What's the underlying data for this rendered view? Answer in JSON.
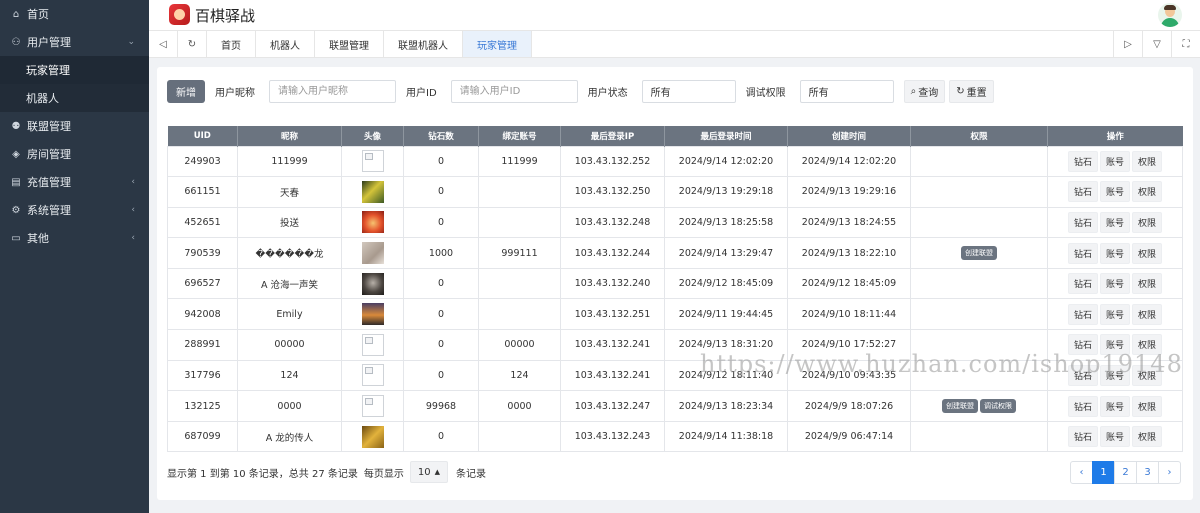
{
  "app": {
    "title": "百棋驿战"
  },
  "sidebar": {
    "items": [
      {
        "label": "首页",
        "icon": "home-icon",
        "glyph": "⌂"
      },
      {
        "label": "用户管理",
        "icon": "users-icon",
        "glyph": "⚇",
        "arrow": "⌄"
      },
      {
        "label": "联盟管理",
        "icon": "group-icon",
        "glyph": "⚉"
      },
      {
        "label": "房间管理",
        "icon": "diamond-icon",
        "glyph": "◈"
      },
      {
        "label": "充值管理",
        "icon": "document-icon",
        "glyph": "▤",
        "arrow": "‹"
      },
      {
        "label": "系统管理",
        "icon": "gear-icon",
        "glyph": "⚙",
        "arrow": "‹"
      },
      {
        "label": "其他",
        "icon": "briefcase-icon",
        "glyph": "▭",
        "arrow": "‹"
      }
    ],
    "submenu": [
      {
        "label": "玩家管理"
      },
      {
        "label": "机器人"
      }
    ]
  },
  "tabsbar": {
    "tabs": [
      "首页",
      "机器人",
      "联盟管理",
      "联盟机器人",
      "玩家管理"
    ],
    "active_index": 4
  },
  "filters": {
    "add_label": "新增",
    "nickname_label": "用户昵称",
    "nickname_placeholder": "请输入用户昵称",
    "userid_label": "用户ID",
    "userid_placeholder": "请输入用户ID",
    "status_label": "用户状态",
    "status_value": "所有",
    "debug_label": "调试权限",
    "debug_value": "所有",
    "search_label": "查询",
    "reset_label": "重置"
  },
  "table": {
    "columns": [
      "UID",
      "昵称",
      "头像",
      "钻石数",
      "绑定账号",
      "最后登录IP",
      "最后登录时间",
      "创建时间",
      "权限",
      "操作"
    ],
    "actions": [
      "钻石",
      "账号",
      "权限"
    ],
    "rows": [
      {
        "uid": "249903",
        "nick": "111999",
        "avatar": "broken",
        "diamonds": "0",
        "bound": "111999",
        "ip": "103.43.132.252",
        "last_login": "2024/9/14 12:02:20",
        "created": "2024/9/14 12:02:20",
        "perms": []
      },
      {
        "uid": "661151",
        "nick": "天春",
        "avatar": "t-leaf",
        "diamonds": "0",
        "bound": "",
        "ip": "103.43.132.250",
        "last_login": "2024/9/13 19:29:18",
        "created": "2024/9/13 19:29:16",
        "perms": []
      },
      {
        "uid": "452651",
        "nick": "投送",
        "avatar": "t-red",
        "diamonds": "0",
        "bound": "",
        "ip": "103.43.132.248",
        "last_login": "2024/9/13 18:25:58",
        "created": "2024/9/13 18:24:55",
        "perms": []
      },
      {
        "uid": "790539",
        "nick": "������龙",
        "avatar": "t-wall",
        "diamonds": "1000",
        "bound": "999111",
        "ip": "103.43.132.244",
        "last_login": "2024/9/14 13:29:47",
        "created": "2024/9/13 18:22:10",
        "perms": [
          "创建联盟"
        ]
      },
      {
        "uid": "696527",
        "nick": "A 沧海一声笑",
        "avatar": "t-cat",
        "diamonds": "0",
        "bound": "",
        "ip": "103.43.132.240",
        "last_login": "2024/9/12 18:45:09",
        "created": "2024/9/12 18:45:09",
        "perms": []
      },
      {
        "uid": "942008",
        "nick": "Emily",
        "avatar": "t-sunset",
        "diamonds": "0",
        "bound": "",
        "ip": "103.43.132.251",
        "last_login": "2024/9/11 19:44:45",
        "created": "2024/9/10 18:11:44",
        "perms": []
      },
      {
        "uid": "288991",
        "nick": "00000",
        "avatar": "broken",
        "diamonds": "0",
        "bound": "00000",
        "ip": "103.43.132.241",
        "last_login": "2024/9/13 18:31:20",
        "created": "2024/9/10 17:52:27",
        "perms": []
      },
      {
        "uid": "317796",
        "nick": "124",
        "avatar": "broken",
        "diamonds": "0",
        "bound": "124",
        "ip": "103.43.132.241",
        "last_login": "2024/9/12 18:11:40",
        "created": "2024/9/10 09:43:35",
        "perms": []
      },
      {
        "uid": "132125",
        "nick": "0000",
        "avatar": "broken",
        "diamonds": "99968",
        "bound": "0000",
        "ip": "103.43.132.247",
        "last_login": "2024/9/13 18:23:34",
        "created": "2024/9/9 18:07:26",
        "perms": [
          "创建联盟",
          "调试权限"
        ]
      },
      {
        "uid": "687099",
        "nick": "A 龙的传人",
        "avatar": "t-gold",
        "diamonds": "0",
        "bound": "",
        "ip": "103.43.132.243",
        "last_login": "2024/9/14 11:38:18",
        "created": "2024/9/9 06:47:14",
        "perms": []
      }
    ]
  },
  "footer": {
    "info_prefix": "显示第 1 到第 10 条记录，总共 27 条记录",
    "per_page_label": "每页显示",
    "per_page_value": "10",
    "per_page_suffix": "条记录",
    "pages": [
      "‹",
      "1",
      "2",
      "3",
      "›"
    ],
    "active_page": "1"
  },
  "watermark": "https://www.huzhan.com/ishop19148"
}
